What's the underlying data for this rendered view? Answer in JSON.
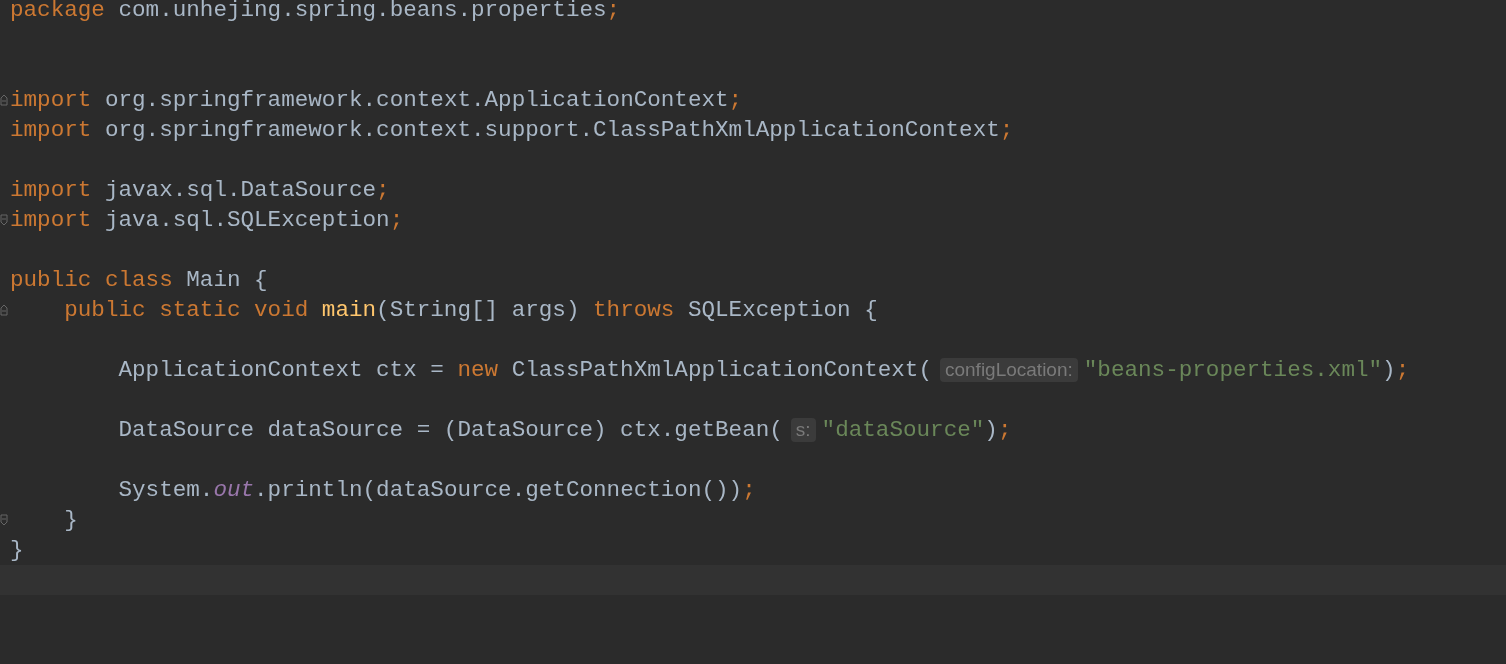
{
  "editor": {
    "lines": [
      {
        "kind": "code",
        "tokens": [
          {
            "kind": "keyword",
            "text": "package"
          },
          {
            "kind": "plain",
            "text": " com.unhejing.spring.beans.properties"
          },
          {
            "kind": "keyword",
            "text": ";"
          }
        ]
      },
      {
        "kind": "blank"
      },
      {
        "kind": "blank"
      },
      {
        "kind": "code",
        "tokens": [
          {
            "kind": "keyword",
            "text": "import"
          },
          {
            "kind": "plain",
            "text": " org.springframework.context.ApplicationContext"
          },
          {
            "kind": "keyword",
            "text": ";"
          }
        ]
      },
      {
        "kind": "code",
        "tokens": [
          {
            "kind": "keyword",
            "text": "import"
          },
          {
            "kind": "plain",
            "text": " org.springframework.context.support.ClassPathXmlApplicationContext"
          },
          {
            "kind": "keyword",
            "text": ";"
          }
        ]
      },
      {
        "kind": "blank"
      },
      {
        "kind": "code",
        "tokens": [
          {
            "kind": "keyword",
            "text": "import"
          },
          {
            "kind": "plain",
            "text": " javax.sql.DataSource"
          },
          {
            "kind": "keyword",
            "text": ";"
          }
        ]
      },
      {
        "kind": "code",
        "tokens": [
          {
            "kind": "keyword",
            "text": "import"
          },
          {
            "kind": "plain",
            "text": " java.sql.SQLException"
          },
          {
            "kind": "keyword",
            "text": ";"
          }
        ]
      },
      {
        "kind": "blank"
      },
      {
        "kind": "code",
        "tokens": [
          {
            "kind": "keyword",
            "text": "public class"
          },
          {
            "kind": "plain",
            "text": " Main {"
          }
        ],
        "children": [
          {
            "kind": "code",
            "tokens": [
              {
                "kind": "keyword",
                "text": "public static void"
              },
              {
                "kind": "method",
                "text": " main"
              },
              {
                "kind": "plain",
                "text": "(String[] args)"
              },
              {
                "kind": "keyword",
                "text": " throws"
              },
              {
                "kind": "plain",
                "text": " SQLException {"
              }
            ],
            "children": [
              {
                "kind": "blank"
              },
              {
                "kind": "code",
                "tokens": [
                  {
                    "kind": "plain",
                    "text": "ApplicationContext ctx ="
                  },
                  {
                    "kind": "keyword",
                    "text": " new"
                  },
                  {
                    "kind": "plain",
                    "text": " ClassPathXmlApplicationContext("
                  },
                  {
                    "kind": "hint",
                    "text": "configLocation:"
                  },
                  {
                    "kind": "string",
                    "text": "\"beans-properties.xml\""
                  },
                  {
                    "kind": "plain",
                    "text": ")"
                  },
                  {
                    "kind": "keyword",
                    "text": ";"
                  }
                ]
              },
              {
                "kind": "blank"
              },
              {
                "kind": "code",
                "tokens": [
                  {
                    "kind": "plain",
                    "text": "DataSource dataSource = (DataSource) ctx.getBean("
                  },
                  {
                    "kind": "hint",
                    "text": "s:"
                  },
                  {
                    "kind": "string",
                    "text": "\"dataSource\""
                  },
                  {
                    "kind": "plain",
                    "text": ")"
                  },
                  {
                    "kind": "keyword",
                    "text": ";"
                  }
                ]
              },
              {
                "kind": "blank"
              },
              {
                "kind": "code",
                "tokens": [
                  {
                    "kind": "plain",
                    "text": "System."
                  },
                  {
                    "kind": "field",
                    "text": "out"
                  },
                  {
                    "kind": "plain",
                    "text": ".println(dataSource.getConnection())"
                  },
                  {
                    "kind": "keyword",
                    "text": ";"
                  }
                ]
              }
            ]
          },
          {
            "kind": "code",
            "tokens": [
              {
                "kind": "plain",
                "text": "}"
              }
            ]
          }
        ]
      },
      {
        "kind": "code",
        "tokens": [
          {
            "kind": "plain",
            "text": "}"
          }
        ]
      },
      {
        "kind": "blank",
        "current": true
      }
    ]
  }
}
